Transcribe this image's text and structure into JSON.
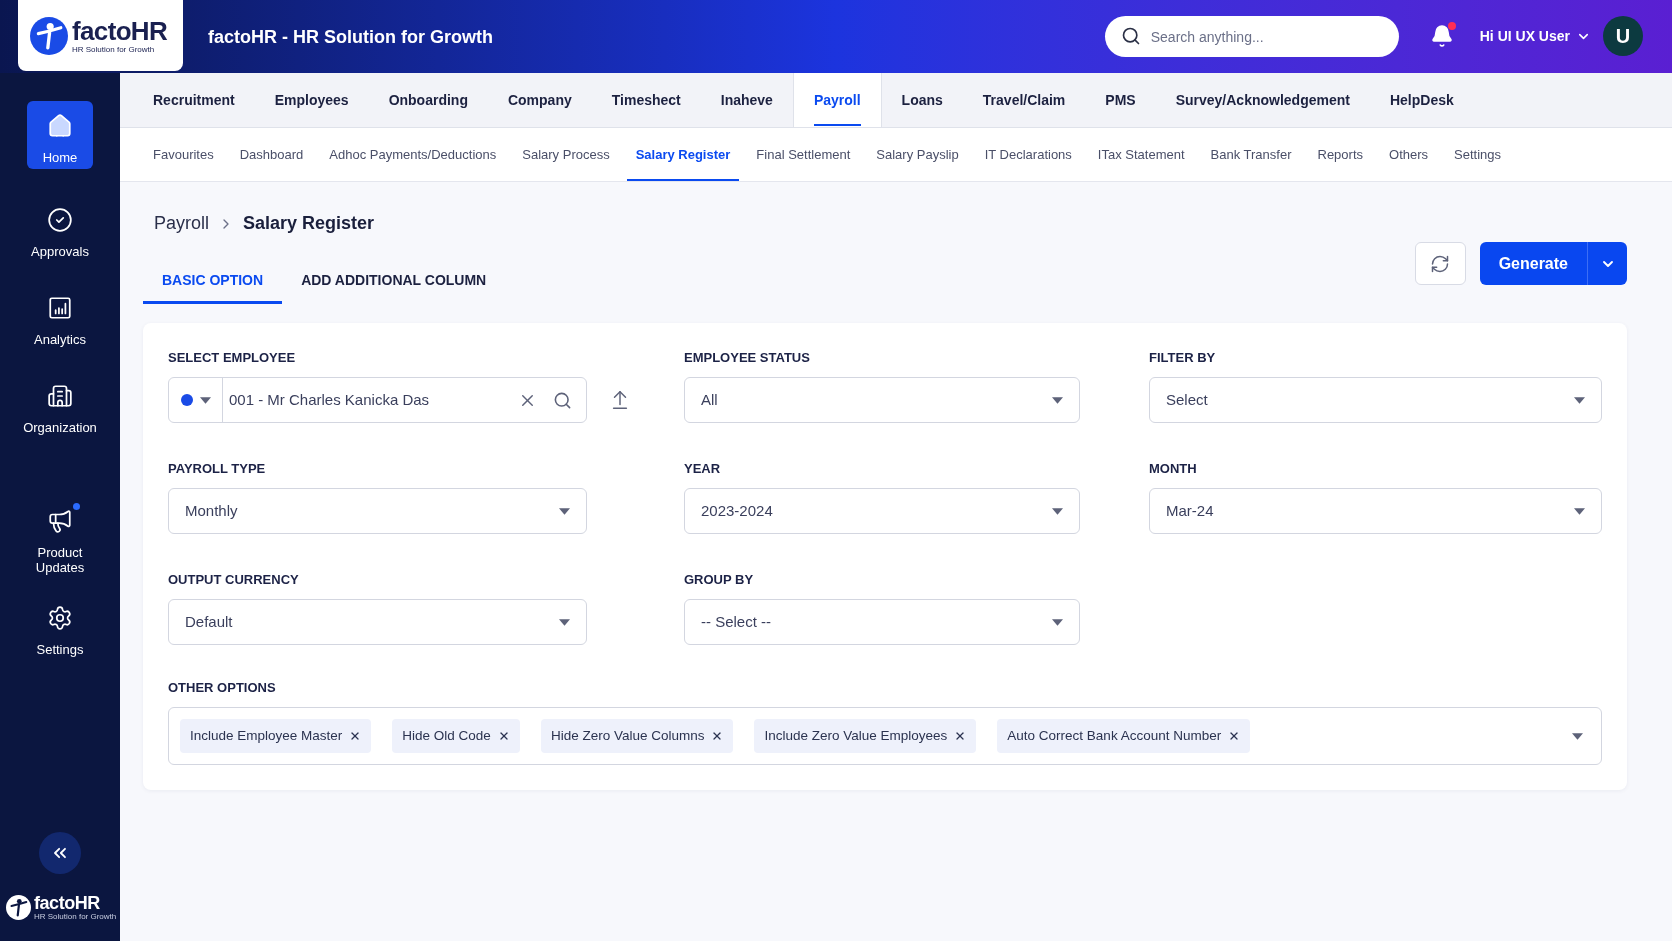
{
  "header": {
    "logo": {
      "name": "factoHR",
      "tagline": "HR Solution for Growth"
    },
    "title": "factoHR - HR Solution for Growth",
    "search": {
      "placeholder": "Search anything..."
    },
    "notifications": {
      "unread": true
    },
    "user": {
      "greeting": "Hi UI UX User",
      "initial": "U"
    }
  },
  "sidebar": {
    "items": [
      {
        "label": "Home",
        "selected": true
      },
      {
        "label": "Approvals",
        "selected": false
      },
      {
        "label": "Analytics",
        "selected": false
      },
      {
        "label": "Organization",
        "selected": false
      }
    ],
    "extra_items": [
      {
        "label": "Product Updates",
        "selected": false,
        "unread": true
      },
      {
        "label": "Settings",
        "selected": false,
        "unread": false
      }
    ],
    "footer_logo": {
      "name": "factoHR",
      "tagline": "HR Solution for Growth"
    }
  },
  "nav_tabs": [
    {
      "label": "Recruitment",
      "selected": false
    },
    {
      "label": "Employees",
      "selected": false
    },
    {
      "label": "Onboarding",
      "selected": false
    },
    {
      "label": "Company",
      "selected": false
    },
    {
      "label": "Timeshect",
      "selected": false
    },
    {
      "label": "Inaheve",
      "selected": false
    },
    {
      "label": "Payroll",
      "selected": true
    },
    {
      "label": "Loans",
      "selected": false
    },
    {
      "label": "Travel/Claim",
      "selected": false
    },
    {
      "label": "PMS",
      "selected": false
    },
    {
      "label": "Survey/Acknowledgement",
      "selected": false
    },
    {
      "label": "HelpDesk",
      "selected": false
    }
  ],
  "sub_tabs": [
    {
      "label": "Favourites",
      "selected": false
    },
    {
      "label": "Dashboard",
      "selected": false
    },
    {
      "label": "Adhoc Payments/Deductions",
      "selected": false
    },
    {
      "label": "Salary Process",
      "selected": false
    },
    {
      "label": "Salary Register",
      "selected": true
    },
    {
      "label": "Final Settlement",
      "selected": false
    },
    {
      "label": "Salary Payslip",
      "selected": false
    },
    {
      "label": "IT Declarations",
      "selected": false
    },
    {
      "label": "ITax Statement",
      "selected": false
    },
    {
      "label": "Bank Transfer",
      "selected": false
    },
    {
      "label": "Reports",
      "selected": false
    },
    {
      "label": "Others",
      "selected": false
    },
    {
      "label": "Settings",
      "selected": false
    }
  ],
  "breadcrumb": [
    "Payroll",
    "Salary Register"
  ],
  "view_tabs": [
    {
      "label": "BASIC OPTION",
      "selected": true
    },
    {
      "label": "ADD ADDITIONAL COLUMN",
      "selected": false
    }
  ],
  "actions": {
    "generate": "Generate"
  },
  "form": {
    "fields": [
      {
        "kind": "employee",
        "label": "SELECT EMPLOYEE",
        "value": "001 - Mr Charles Kanicka Das"
      },
      {
        "kind": "select",
        "label": "EMPLOYEE STATUS",
        "value": "All"
      },
      {
        "kind": "select",
        "label": "FILTER BY",
        "value": "Select"
      },
      {
        "kind": "select",
        "label": "PAYROLL TYPE",
        "value": "Monthly"
      },
      {
        "kind": "select",
        "label": "YEAR",
        "value": "2023-2024"
      },
      {
        "kind": "select",
        "label": "MONTH",
        "value": "Mar-24"
      },
      {
        "kind": "select",
        "label": "OUTPUT CURRENCY",
        "value": "Default"
      },
      {
        "kind": "select",
        "label": "GROUP BY",
        "value": "-- Select --"
      }
    ],
    "other_options": {
      "label": "OTHER OPTIONS",
      "chips": [
        "Include Employee Master",
        "Hide Old Code",
        "Hide Zero Value Columns",
        "Include Zero Value Employees",
        "Auto Correct Bank Account Number"
      ]
    }
  }
}
